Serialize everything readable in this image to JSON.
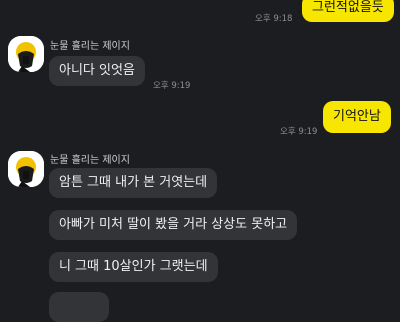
{
  "messages": [
    {
      "dir": "out",
      "text": "그런적없을듯",
      "time": "오후 9:18"
    },
    {
      "dir": "in",
      "sender": "눈물 흘리는 제이지",
      "text": "아니다 잇엇음",
      "time": "오후 9:19"
    },
    {
      "dir": "out",
      "text": "기억안남",
      "time": "오후 9:19"
    },
    {
      "dir": "in",
      "sender": "눈물 흘리는 제이지",
      "text": "암튼 그때 내가 본 거엿는데"
    },
    {
      "dir": "in",
      "text": "아빠가 미처 딸이 봤을 거라 상상도 못하고"
    },
    {
      "dir": "in",
      "text": "니 그때 10살인가 그랫는데"
    }
  ],
  "colors": {
    "background": "#1c1d21",
    "outgoing_bubble": "#f7e600",
    "incoming_bubble": "#333438"
  },
  "avatar_icon": "crying-jay-z-avatar-icon"
}
